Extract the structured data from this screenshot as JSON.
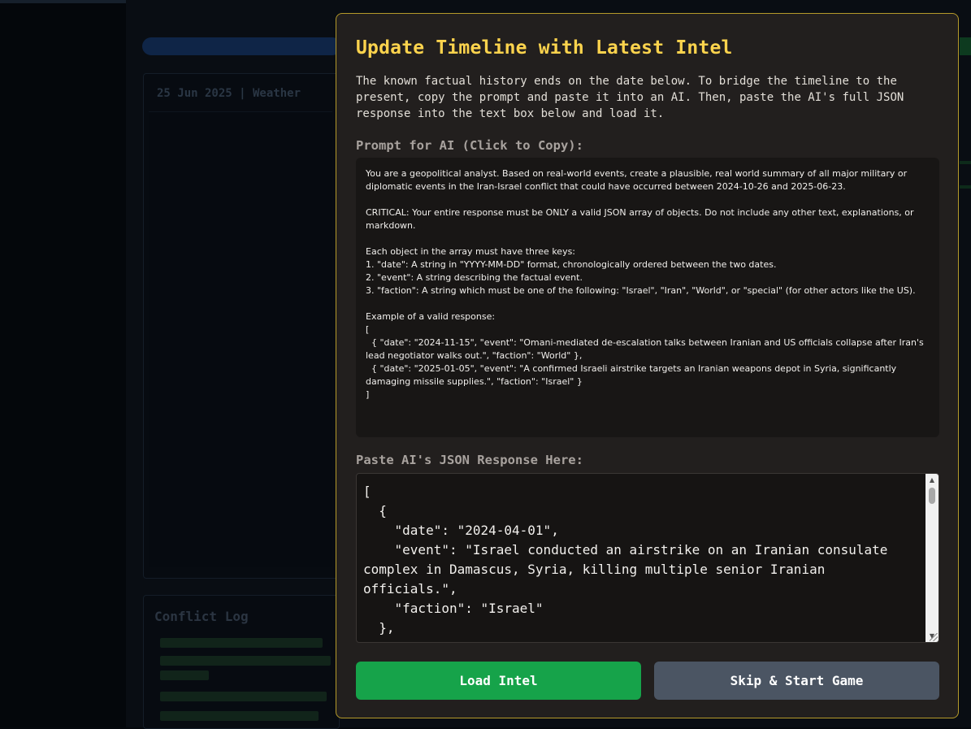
{
  "background": {
    "date_header": "25 Jun 2025 | Weather",
    "log_title": "Conflict Log"
  },
  "modal": {
    "title": "Update Timeline with Latest Intel",
    "description": "The known factual history ends on the date below. To bridge the timeline to the present, copy the prompt and paste it into an AI. Then, paste the AI's full JSON response into the text box below and load it.",
    "prompt_label": "Prompt for AI (Click to Copy):",
    "prompt_text": "You are a geopolitical analyst. Based on real-world events, create a plausible, real world summary of all major military or diplomatic events in the Iran-Israel conflict that could have occurred between 2024-10-26 and 2025-06-23.\n\nCRITICAL: Your entire response must be ONLY a valid JSON array of objects. Do not include any other text, explanations, or markdown.\n\nEach object in the array must have three keys:\n1. \"date\": A string in \"YYYY-MM-DD\" format, chronologically ordered between the two dates.\n2. \"event\": A string describing the factual event.\n3. \"faction\": A string which must be one of the following: \"Israel\", \"Iran\", \"World\", or \"special\" (for other actors like the US).\n\nExample of a valid response:\n[\n  { \"date\": \"2024-11-15\", \"event\": \"Omani-mediated de-escalation talks between Iranian and US officials collapse after Iran's lead negotiator walks out.\", \"faction\": \"World\" },\n  { \"date\": \"2025-01-05\", \"event\": \"A confirmed Israeli airstrike targets an Iranian weapons depot in Syria, significantly damaging missile supplies.\", \"faction\": \"Israel\" }\n]",
    "paste_label": "Paste AI's JSON Response Here:",
    "json_value": "[\n  {\n    \"date\": \"2024-04-01\",\n    \"event\": \"Israel conducted an airstrike on an Iranian consulate complex in Damascus, Syria, killing multiple senior Iranian officials.\",\n    \"faction\": \"Israel\"\n  },\n  {",
    "load_button": "Load Intel",
    "skip_button": "Skip & Start Game"
  },
  "colors": {
    "title": "#fcd34d",
    "modal_border": "#b59a2a",
    "load_button": "#16a34a",
    "skip_button": "#4b5563"
  }
}
